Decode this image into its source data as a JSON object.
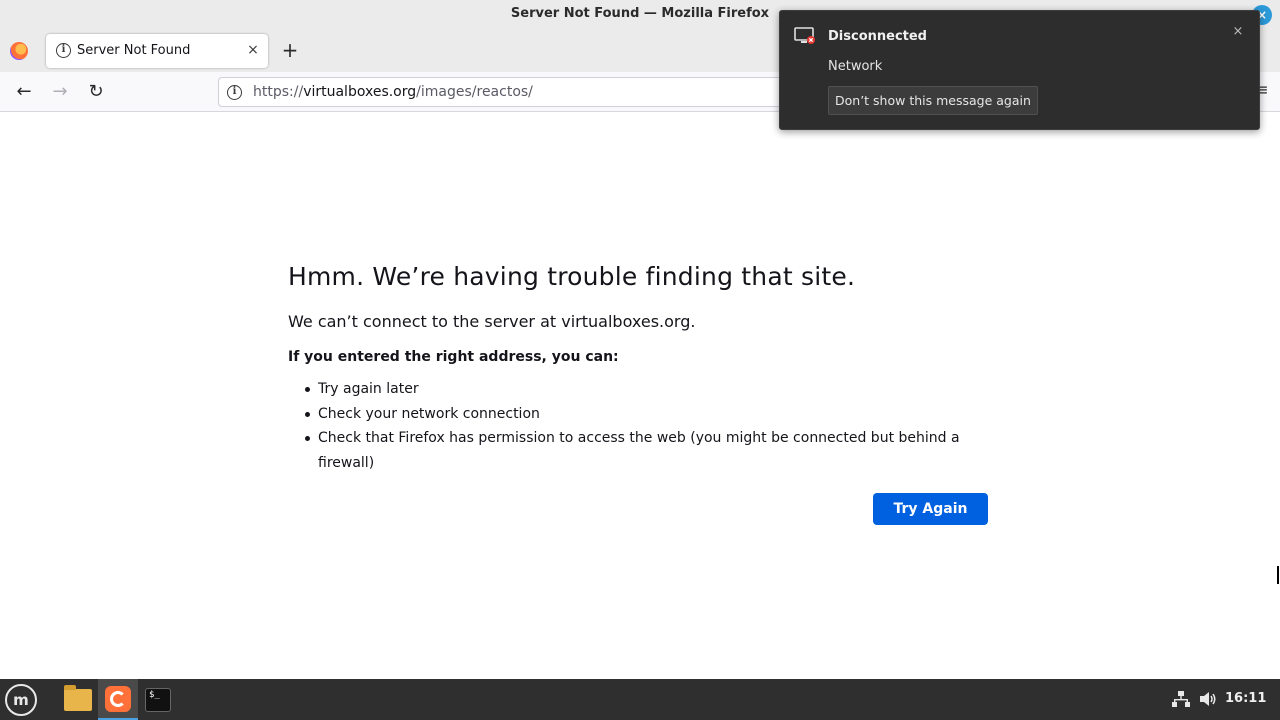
{
  "window": {
    "title": "Server Not Found — Mozilla Firefox"
  },
  "tab": {
    "title": "Server Not Found",
    "close_glyph": "×"
  },
  "new_tab_glyph": "+",
  "nav": {
    "back_glyph": "←",
    "forward_glyph": "→",
    "reload_glyph": "↻",
    "menu_glyph": "≡"
  },
  "urlbar": {
    "scheme": "https://",
    "host": "virtualboxes.org",
    "path": "/images/reactos/"
  },
  "error": {
    "title": "Hmm. We’re having trouble finding that site.",
    "description": "We can’t connect to the server at virtualboxes.org.",
    "subheading": "If you entered the right address, you can:",
    "suggestions": [
      "Try again later",
      "Check your network connection",
      "Check that Firefox has permission to access the web (you might be connected but behind a firewall)"
    ],
    "try_again_label": "Try Again"
  },
  "notification": {
    "title": "Disconnected",
    "body": "Network",
    "action_label": "Don’t show this message again",
    "close_glyph": "×",
    "icon": "network-disconnected-icon"
  },
  "taskbar": {
    "menu_glyph": "m",
    "apps": [
      "files-icon",
      "firefox-icon",
      "terminal-icon"
    ],
    "terminal_glyph": "$_",
    "tray": {
      "network_glyph": "⌘",
      "volume_glyph": "🔊"
    },
    "clock": "16:11"
  },
  "colors": {
    "accent": "#0061e0",
    "taskbar": "#2f2f2f",
    "notification_bg": "#2d2d2d"
  }
}
